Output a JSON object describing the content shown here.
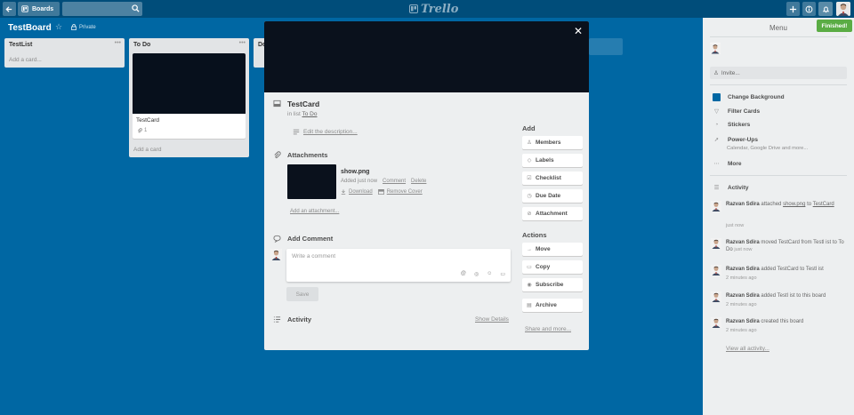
{
  "header": {
    "boards_label": "Boards",
    "logo_text": "Trello"
  },
  "board": {
    "title": "TestBoard",
    "privacy": "Private"
  },
  "lists": [
    {
      "name": "TestList",
      "add_card": "Add a card..."
    },
    {
      "name": "To Do",
      "card_title": "TestCard",
      "card_badge": "1",
      "add_card": "Add a card"
    },
    {
      "name": "Do"
    }
  ],
  "modal": {
    "card_title": "TestCard",
    "in_list_prefix": "in list",
    "in_list_name": "To Do",
    "edit_description": "Edit the description...",
    "attachments_title": "Attachments",
    "attachment": {
      "name": "show.png",
      "added": "Added just now",
      "comment": "Comment",
      "delete": "Delete",
      "download": "Download",
      "remove_cover": "Remove Cover"
    },
    "add_attachment": "Add an attachment...",
    "add_comment_title": "Add Comment",
    "comment_placeholder": "Write a comment",
    "save_label": "Save",
    "activity_title": "Activity",
    "show_details": "Show Details",
    "add_title": "Add",
    "add_buttons": [
      "Members",
      "Labels",
      "Checklist",
      "Due Date",
      "Attachment"
    ],
    "actions_title": "Actions",
    "action_buttons": [
      "Move",
      "Copy",
      "Subscribe",
      "Archive"
    ],
    "share_more": "Share and more..."
  },
  "menu": {
    "title": "Menu",
    "finished_badge": "Finished!",
    "invite": "Invite...",
    "items": [
      {
        "label": "Change Background"
      },
      {
        "label": "Filter Cards"
      },
      {
        "label": "Stickers"
      },
      {
        "label": "Power-Ups",
        "sub": "Calendar, Google Drive and more..."
      },
      {
        "label": "More"
      }
    ],
    "activity_title": "Activity",
    "activity": [
      {
        "user": "Razvan Sdira",
        "text": "attached",
        "link": "show.png",
        "text2": "to",
        "link2": "TestCard",
        "time": "just now"
      },
      {
        "user": "Razvan Sdira",
        "text": "moved TestCard from Testl ist to To Do",
        "time": "just now"
      },
      {
        "user": "Razvan Sdira",
        "text": "added TestCard to Testl ist",
        "time": "2 minutes ago"
      },
      {
        "user": "Razvan Sdira",
        "text": "added Testl ist to this board",
        "time": "2 minutes ago"
      },
      {
        "user": "Razvan Sdira",
        "text": "created this board",
        "time": "2 minutes ago"
      }
    ],
    "view_all": "View all activity..."
  },
  "colors": {
    "board_bg": "#0067a3",
    "header_bg": "#004d7a",
    "finished": "#5aac44"
  }
}
